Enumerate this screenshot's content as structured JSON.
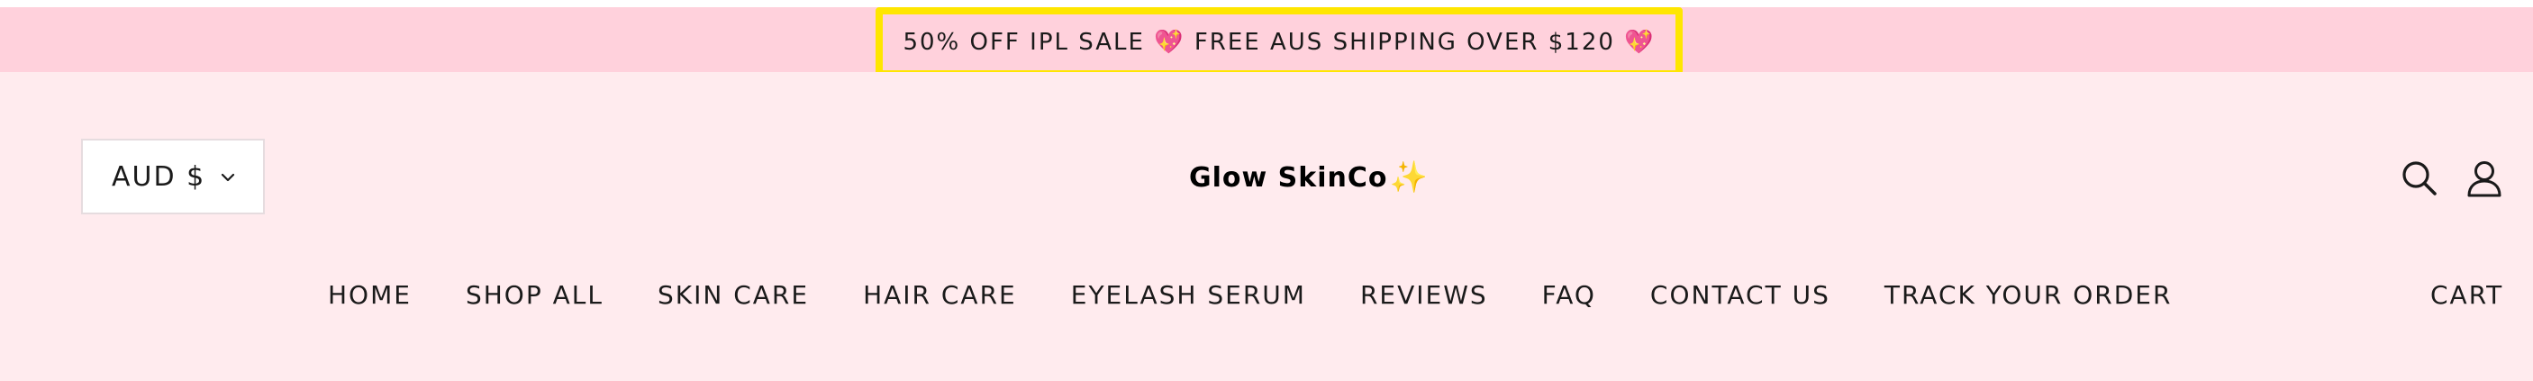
{
  "announcement": {
    "text_part1": "50% OFF IPL SALE",
    "text_part2": "FREE AUS SHIPPING OVER $120",
    "heart_glyph": "💖",
    "highlight_color": "#ffe600",
    "bar_color": "#ffd1dc"
  },
  "header": {
    "background_color": "#ffebee",
    "currency": {
      "selected": "AUD $"
    },
    "logo": {
      "text": "Glow SkinCo",
      "sparkle_glyph": "✨"
    },
    "icons": {
      "search": "search-icon",
      "account": "account-icon"
    }
  },
  "nav": {
    "items": [
      {
        "label": "HOME"
      },
      {
        "label": "SHOP ALL"
      },
      {
        "label": "SKIN CARE"
      },
      {
        "label": "HAIR CARE"
      },
      {
        "label": "EYELASH SERUM"
      },
      {
        "label": "REVIEWS"
      },
      {
        "label": "FAQ"
      },
      {
        "label": "CONTACT US"
      },
      {
        "label": "TRACK YOUR ORDER"
      }
    ],
    "cart_label": "CART"
  }
}
